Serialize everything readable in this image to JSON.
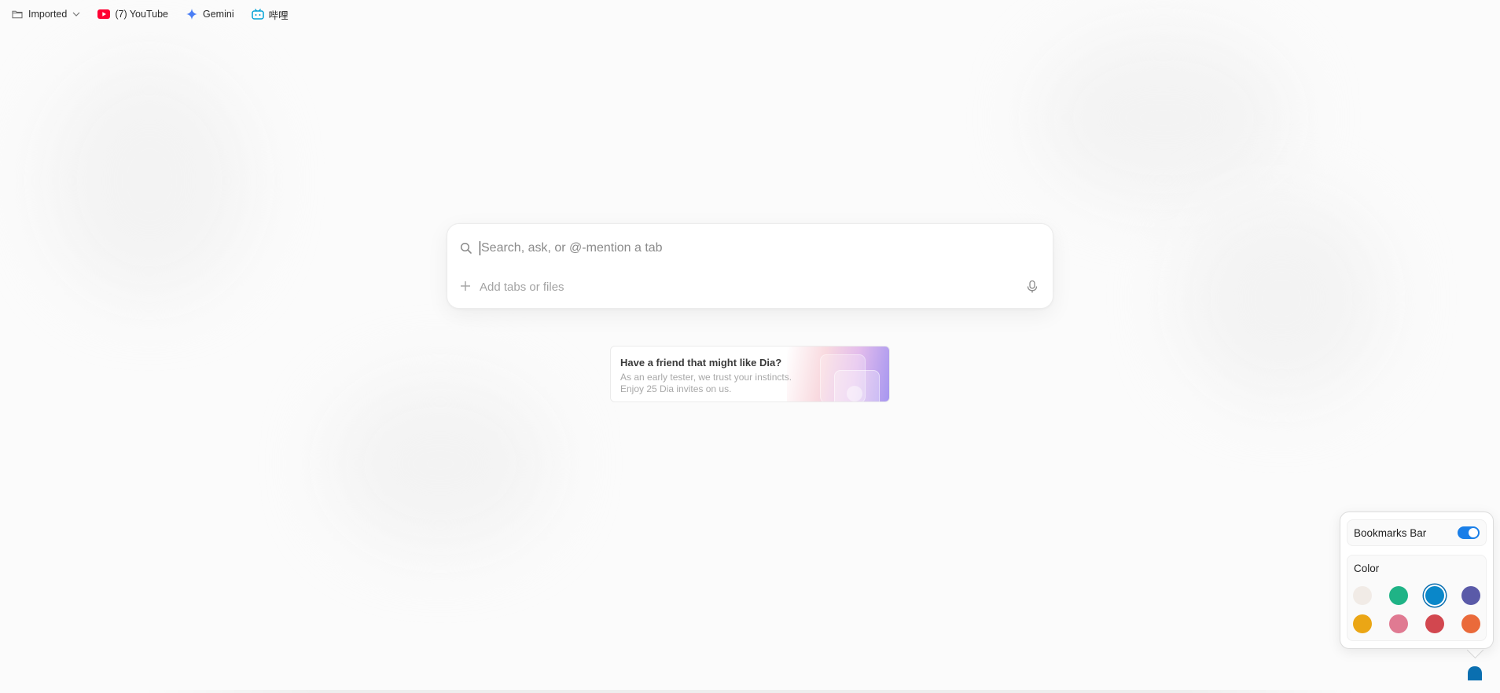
{
  "bookmarks": {
    "items": [
      {
        "label": "Imported",
        "icon": "folder-icon",
        "has_dropdown": true
      },
      {
        "label": "(7) YouTube",
        "icon": "youtube-icon",
        "color": "#ff0033"
      },
      {
        "label": "Gemini",
        "icon": "gemini-icon",
        "color": "#4a7ef5"
      },
      {
        "label": "哔哩",
        "icon": "bilibili-icon",
        "color": "#00a1d6"
      }
    ]
  },
  "search": {
    "placeholder": "Search, ask, or @-mention a tab",
    "value": "",
    "add_label": "Add tabs or files"
  },
  "invite": {
    "title": "Have a friend that might like Dia?",
    "line1": "As an early tester, we trust your instincts.",
    "line2": "Enjoy 25 Dia invites on us."
  },
  "popover": {
    "bookmarks_bar_label": "Bookmarks Bar",
    "bookmarks_bar_enabled": true,
    "color_label": "Color",
    "selected_color": "#0a87c9",
    "colors": [
      "#f1ebe6",
      "#1fb386",
      "#0a87c9",
      "#5a5aa8",
      "#eba615",
      "#e07a92",
      "#d2474f",
      "#ea6a3a"
    ]
  }
}
